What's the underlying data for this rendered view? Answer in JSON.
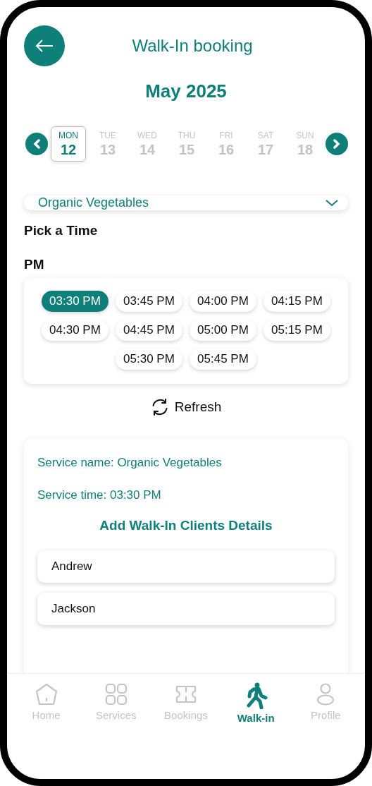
{
  "header": {
    "title": "Walk-In booking"
  },
  "month": "May 2025",
  "days": [
    {
      "weekday": "MON",
      "date": "12",
      "selected": true
    },
    {
      "weekday": "TUE",
      "date": "13",
      "selected": false
    },
    {
      "weekday": "WED",
      "date": "14",
      "selected": false
    },
    {
      "weekday": "THU",
      "date": "15",
      "selected": false
    },
    {
      "weekday": "FRI",
      "date": "16",
      "selected": false
    },
    {
      "weekday": "SAT",
      "date": "17",
      "selected": false
    },
    {
      "weekday": "SUN",
      "date": "18",
      "selected": false
    }
  ],
  "service_select": {
    "value": "Organic Vegetables"
  },
  "pick_time_label": "Pick a Time",
  "period_label": "PM",
  "slots": [
    {
      "time": "03:30 PM",
      "selected": true
    },
    {
      "time": "03:45 PM",
      "selected": false
    },
    {
      "time": "04:00 PM",
      "selected": false
    },
    {
      "time": "04:15 PM",
      "selected": false
    },
    {
      "time": "04:30 PM",
      "selected": false
    },
    {
      "time": "04:45 PM",
      "selected": false
    },
    {
      "time": "05:00 PM",
      "selected": false
    },
    {
      "time": "05:15 PM",
      "selected": false
    },
    {
      "time": "05:30 PM",
      "selected": false
    },
    {
      "time": "05:45 PM",
      "selected": false
    }
  ],
  "refresh_label": "Refresh",
  "details": {
    "service_name": "Service name: Organic Vegetables",
    "service_time": "Service time: 03:30 PM",
    "heading": "Add Walk-In Clients Details",
    "clients": [
      {
        "value": "Andrew"
      },
      {
        "value": "Jackson"
      }
    ]
  },
  "nav": [
    {
      "kind": "home",
      "label": "Home",
      "selected": false
    },
    {
      "kind": "services",
      "label": "Services",
      "selected": false
    },
    {
      "kind": "bookings",
      "label": "Bookings",
      "selected": false
    },
    {
      "kind": "walkin",
      "label": "Walk-in",
      "selected": true
    },
    {
      "kind": "profile",
      "label": "Profile",
      "selected": false
    }
  ]
}
